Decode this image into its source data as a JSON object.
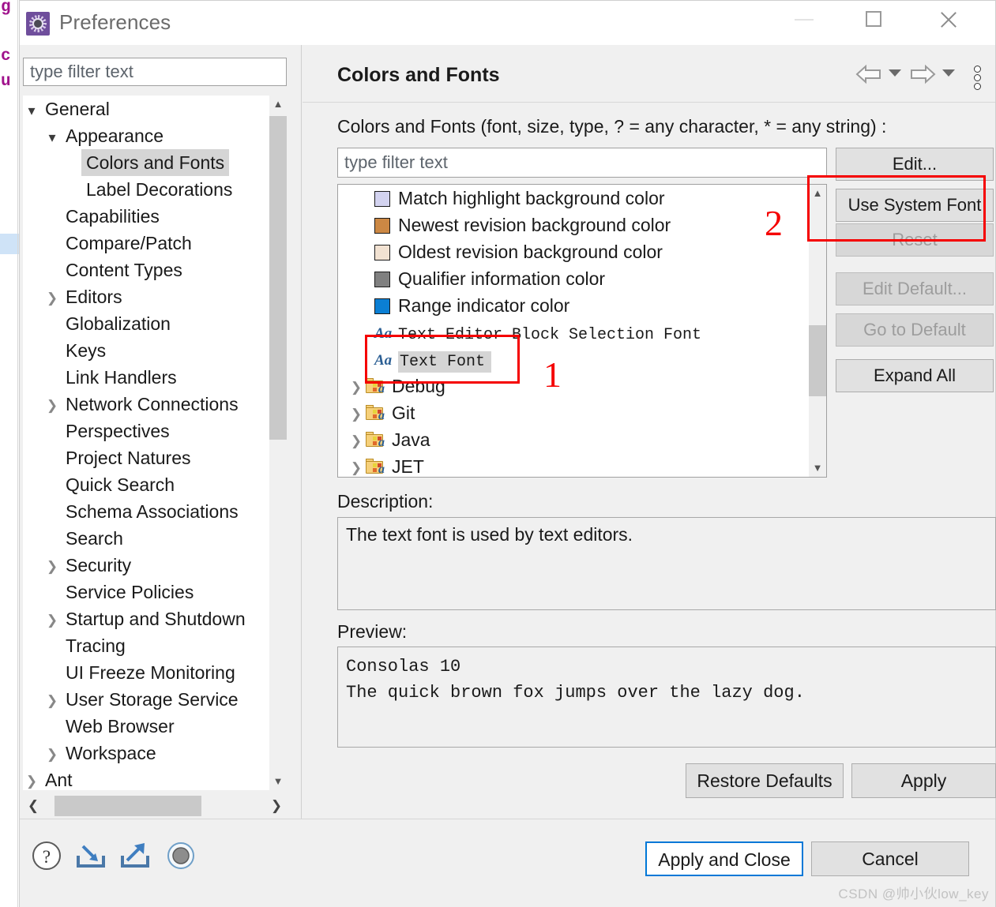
{
  "background_editor": {
    "glyphs": [
      "g",
      "c",
      "u"
    ]
  },
  "window": {
    "title": "Preferences",
    "icon": "preferences-gear-icon",
    "minimize_label": "Minimize",
    "maximize_label": "Maximize",
    "close_label": "Close"
  },
  "sidebar": {
    "filter_placeholder": "type filter text",
    "items": [
      {
        "label": "General",
        "indent": 0,
        "twisty": "open",
        "selected": false
      },
      {
        "label": "Appearance",
        "indent": 1,
        "twisty": "open",
        "selected": false
      },
      {
        "label": "Colors and Fonts",
        "indent": 2,
        "twisty": "none",
        "selected": true
      },
      {
        "label": "Label Decorations",
        "indent": 2,
        "twisty": "none",
        "selected": false
      },
      {
        "label": "Capabilities",
        "indent": 1,
        "twisty": "none",
        "selected": false
      },
      {
        "label": "Compare/Patch",
        "indent": 1,
        "twisty": "none",
        "selected": false
      },
      {
        "label": "Content Types",
        "indent": 1,
        "twisty": "none",
        "selected": false
      },
      {
        "label": "Editors",
        "indent": 1,
        "twisty": "closed",
        "selected": false
      },
      {
        "label": "Globalization",
        "indent": 1,
        "twisty": "none",
        "selected": false
      },
      {
        "label": "Keys",
        "indent": 1,
        "twisty": "none",
        "selected": false
      },
      {
        "label": "Link Handlers",
        "indent": 1,
        "twisty": "none",
        "selected": false
      },
      {
        "label": "Network Connections",
        "indent": 1,
        "twisty": "closed",
        "selected": false
      },
      {
        "label": "Perspectives",
        "indent": 1,
        "twisty": "none",
        "selected": false
      },
      {
        "label": "Project Natures",
        "indent": 1,
        "twisty": "none",
        "selected": false
      },
      {
        "label": "Quick Search",
        "indent": 1,
        "twisty": "none",
        "selected": false
      },
      {
        "label": "Schema Associations",
        "indent": 1,
        "twisty": "none",
        "selected": false
      },
      {
        "label": "Search",
        "indent": 1,
        "twisty": "none",
        "selected": false
      },
      {
        "label": "Security",
        "indent": 1,
        "twisty": "closed",
        "selected": false
      },
      {
        "label": "Service Policies",
        "indent": 1,
        "twisty": "none",
        "selected": false
      },
      {
        "label": "Startup and Shutdown",
        "indent": 1,
        "twisty": "closed",
        "selected": false
      },
      {
        "label": "Tracing",
        "indent": 1,
        "twisty": "none",
        "selected": false
      },
      {
        "label": "UI Freeze Monitoring",
        "indent": 1,
        "twisty": "none",
        "selected": false
      },
      {
        "label": "User Storage Service",
        "indent": 1,
        "twisty": "closed",
        "selected": false
      },
      {
        "label": "Web Browser",
        "indent": 1,
        "twisty": "none",
        "selected": false
      },
      {
        "label": "Workspace",
        "indent": 1,
        "twisty": "closed",
        "selected": false
      },
      {
        "label": "Ant",
        "indent": 0,
        "twisty": "closed",
        "selected": false
      }
    ]
  },
  "page": {
    "title": "Colors and Fonts",
    "filter_label": "Colors and Fonts (font, size, type, ? = any character, * = any string) :",
    "filter_placeholder": "type filter text",
    "nav": {
      "back": "back-arrow",
      "back_menu": "back-dropdown",
      "forward": "forward-arrow",
      "forward_menu": "forward-dropdown",
      "overflow": "view-menu"
    },
    "list": [
      {
        "label": "Match highlight background color",
        "kind": "color",
        "color": "#d3d3f0",
        "indent": 1,
        "twisty": "none",
        "selected": false
      },
      {
        "label": "Newest revision background color",
        "kind": "color",
        "color": "#cc8844",
        "indent": 1,
        "twisty": "none",
        "selected": false
      },
      {
        "label": "Oldest revision background color",
        "kind": "color",
        "color": "#f2e2d2",
        "indent": 1,
        "twisty": "none",
        "selected": false
      },
      {
        "label": "Qualifier information color",
        "kind": "color",
        "color": "#808080",
        "indent": 1,
        "twisty": "none",
        "selected": false
      },
      {
        "label": "Range indicator color",
        "kind": "color",
        "color": "#0b7fd4",
        "indent": 1,
        "twisty": "none",
        "selected": false
      },
      {
        "label": "Text Editor Block Selection Font",
        "kind": "font",
        "color": "",
        "indent": 1,
        "twisty": "none",
        "selected": false
      },
      {
        "label": "Text Font",
        "kind": "font",
        "color": "",
        "indent": 1,
        "twisty": "none",
        "selected": true
      },
      {
        "label": "Debug",
        "kind": "folder",
        "color": "",
        "indent": 0,
        "twisty": "closed",
        "selected": false
      },
      {
        "label": "Git",
        "kind": "folder",
        "color": "",
        "indent": 0,
        "twisty": "closed",
        "selected": false
      },
      {
        "label": "Java",
        "kind": "folder",
        "color": "",
        "indent": 0,
        "twisty": "closed",
        "selected": false
      },
      {
        "label": "JET",
        "kind": "folder",
        "color": "",
        "indent": 0,
        "twisty": "closed",
        "selected": false
      }
    ],
    "side_buttons": [
      {
        "label": "Edit...",
        "disabled": false
      },
      {
        "label": "Use System Font",
        "disabled": false
      },
      {
        "label": "Reset",
        "disabled": true
      },
      {
        "label": "Edit Default...",
        "disabled": true
      },
      {
        "label": "Go to Default",
        "disabled": true
      },
      {
        "label": "Expand All",
        "disabled": false
      }
    ],
    "description_label": "Description:",
    "description_text": "The text font is used by text editors.",
    "preview_label": "Preview:",
    "preview_line1": "Consolas 10",
    "preview_line2": "The quick brown fox jumps over the lazy dog.",
    "restore_defaults_label": "Restore Defaults",
    "apply_label": "Apply"
  },
  "footer": {
    "icons": [
      "help-icon",
      "import-icon",
      "export-icon",
      "record-icon"
    ],
    "apply_and_close_label": "Apply and Close",
    "cancel_label": "Cancel",
    "watermark": "CSDN @帅小伙low_key"
  },
  "annotations": [
    {
      "number": "1"
    },
    {
      "number": "2"
    }
  ],
  "colors": {
    "accent": "#0078d7",
    "annotation": "#f50000",
    "dialog_bg": "#f0f0f0",
    "selection": "#d5d5d5"
  }
}
